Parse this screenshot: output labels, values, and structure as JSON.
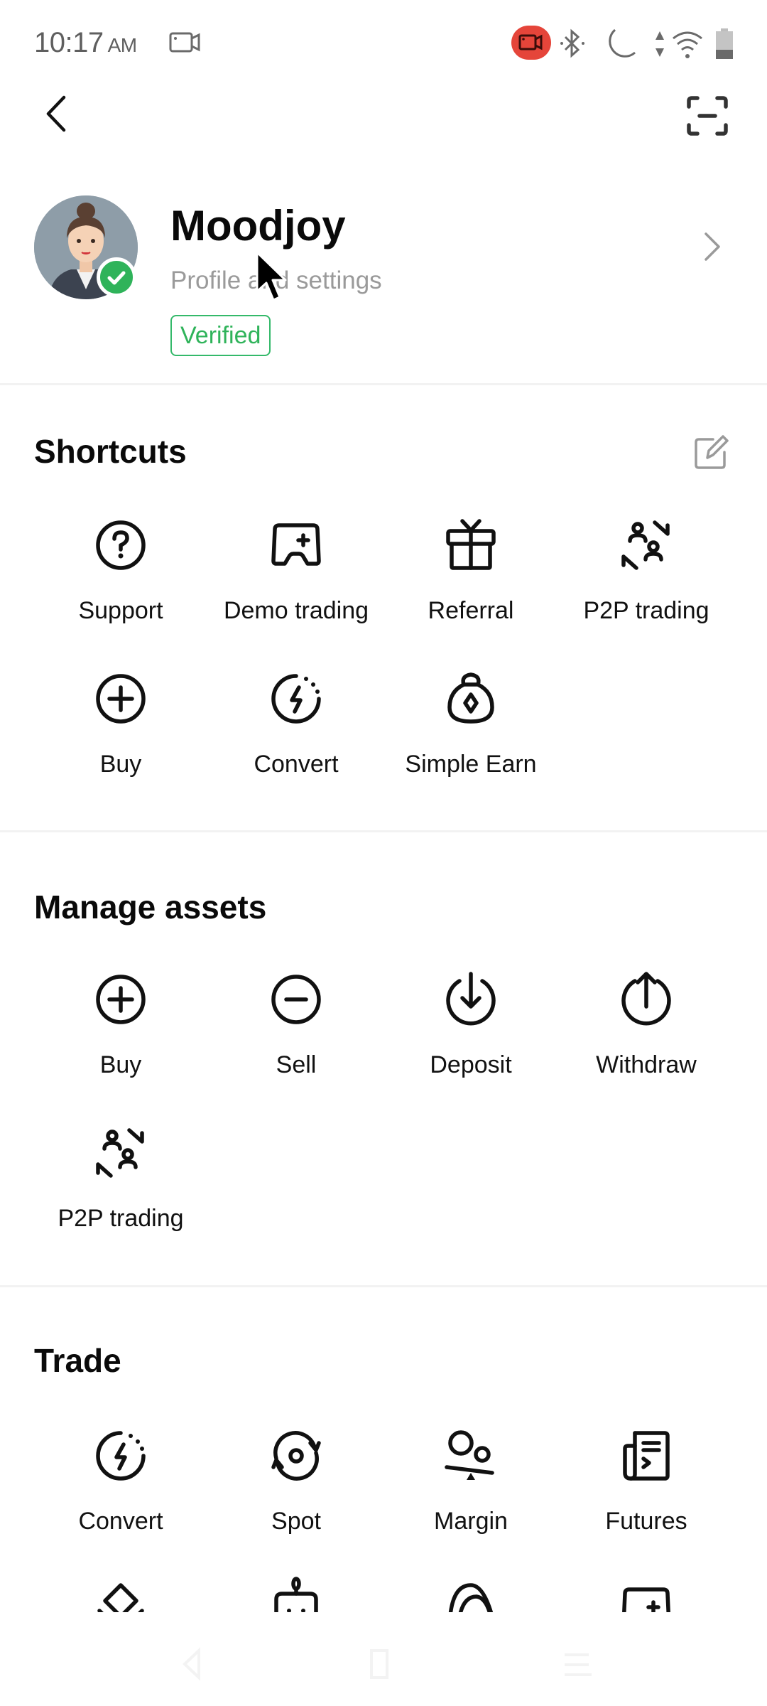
{
  "status_bar": {
    "time": "10:17",
    "ampm": "AM",
    "left_icons": [
      "screen-record-icon"
    ],
    "right_icons": [
      "screen-recording-active-icon",
      "bluetooth-icon",
      "do-not-disturb-moon-icon",
      "data-arrows-icon",
      "wifi-icon",
      "battery-icon"
    ],
    "recording_color": "#e5453a"
  },
  "top_bar": {
    "back_icon": "chevron-left-icon",
    "scan_icon": "scan-icon"
  },
  "profile": {
    "username": "Moodjoy",
    "subtitle": "Profile and settings",
    "badge": "Verified",
    "badge_color": "#2fb35a",
    "avatar": "avatar-businesswoman",
    "verified_check_color": "#2fb35a"
  },
  "sections": {
    "shortcuts": {
      "title": "Shortcuts",
      "edit_icon": "edit-icon",
      "items": [
        {
          "label": "Support",
          "icon": "question-circle-icon"
        },
        {
          "label": "Demo trading",
          "icon": "demo-trading-icon"
        },
        {
          "label": "Referral",
          "icon": "gift-icon"
        },
        {
          "label": "P2P trading",
          "icon": "p2p-exchange-icon"
        },
        {
          "label": "Buy",
          "icon": "plus-circle-icon"
        },
        {
          "label": "Convert",
          "icon": "convert-bolt-icon"
        },
        {
          "label": "Simple Earn",
          "icon": "money-bag-icon"
        }
      ]
    },
    "manage_assets": {
      "title": "Manage assets",
      "items": [
        {
          "label": "Buy",
          "icon": "plus-circle-icon"
        },
        {
          "label": "Sell",
          "icon": "minus-circle-icon"
        },
        {
          "label": "Deposit",
          "icon": "deposit-arrow-down-icon"
        },
        {
          "label": "Withdraw",
          "icon": "withdraw-arrow-up-icon"
        },
        {
          "label": "P2P trading",
          "icon": "p2p-exchange-icon"
        }
      ]
    },
    "trade": {
      "title": "Trade",
      "items": [
        {
          "label": "Convert",
          "icon": "convert-bolt-icon"
        },
        {
          "label": "Spot",
          "icon": "spot-cycle-icon"
        },
        {
          "label": "Margin",
          "icon": "margin-balance-icon"
        },
        {
          "label": "Futures",
          "icon": "futures-document-icon"
        }
      ],
      "partial_items_icons": [
        "diamond-layers-icon",
        "trading-bot-icon",
        "arcs-icon",
        "demo-trading-icon"
      ]
    }
  },
  "nav_bar": {
    "buttons": [
      "nav-back-icon",
      "nav-home-icon",
      "nav-recents-icon"
    ]
  }
}
